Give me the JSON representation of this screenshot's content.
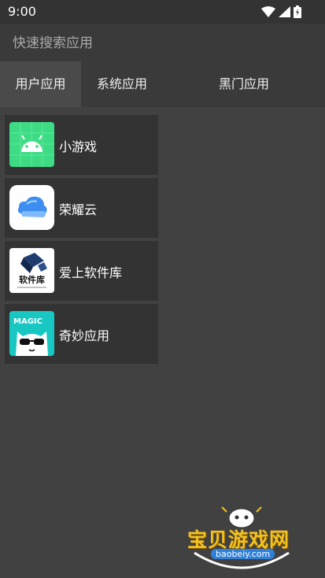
{
  "status": {
    "time": "9:00"
  },
  "search": {
    "placeholder": "快速搜索应用"
  },
  "tabs": [
    {
      "label": "用户应用",
      "active": true
    },
    {
      "label": "系统应用",
      "active": false
    },
    {
      "label": "黑门应用",
      "active": false
    }
  ],
  "apps": [
    {
      "name": "小游戏",
      "icon": "android-icon"
    },
    {
      "name": "荣耀云",
      "icon": "cloud-icon"
    },
    {
      "name": "爱上软件库",
      "icon": "software-library-icon",
      "icon_text": "软件库"
    },
    {
      "name": "奇妙应用",
      "icon": "magic-cat-icon",
      "icon_text": "MAGIC"
    }
  ],
  "watermark": {
    "title": "宝贝游戏网",
    "url": "baobeiy.com"
  },
  "colors": {
    "background": "#414141",
    "bar": "#3a3a3a",
    "active_tab": "#4a4a4a",
    "item": "#333333"
  }
}
